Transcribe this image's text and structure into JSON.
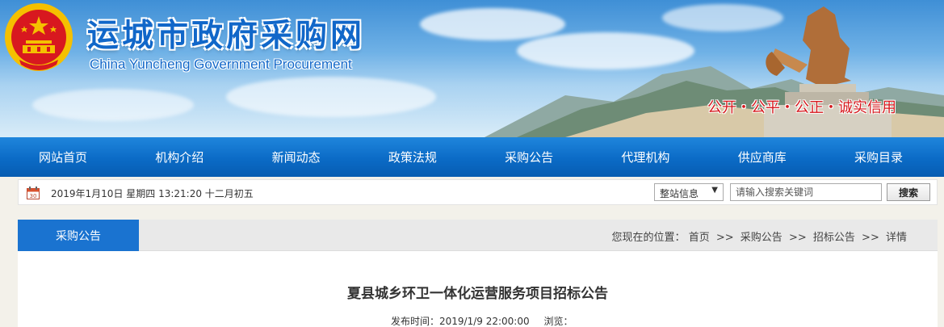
{
  "header": {
    "title": "运城市政府采购网",
    "subtitle": "China Yuncheng Government Procurement",
    "motto": "公开・公平・公正・诚实信用"
  },
  "nav": {
    "items": [
      {
        "label": "网站首页"
      },
      {
        "label": "机构介绍"
      },
      {
        "label": "新闻动态"
      },
      {
        "label": "政策法规"
      },
      {
        "label": "采购公告"
      },
      {
        "label": "代理机构"
      },
      {
        "label": "供应商库"
      },
      {
        "label": "采购目录"
      }
    ]
  },
  "infobar": {
    "calendar_day": "30",
    "datetime": "2019年1月10日 星期四 13:21:20 十二月初五",
    "search_scope": "整站信息",
    "search_placeholder": "请输入搜索关键词",
    "search_button": "搜索"
  },
  "section": {
    "tab_label": "采购公告",
    "breadcrumb_prefix": "您现在的位置：",
    "breadcrumb": [
      "首页",
      "采购公告",
      "招标公告",
      "详情"
    ],
    "separator": ">>"
  },
  "article": {
    "title": "夏县城乡环卫一体化运营服务项目招标公告",
    "publish_label": "发布时间：",
    "publish_time": "2019/1/9 22:00:00",
    "views_label": "浏览："
  },
  "colors": {
    "brand_blue": "#1167c9",
    "nav_blue": "#0b6bc6",
    "tab_blue": "#1a73d0",
    "motto_red": "#d6181d",
    "emblem_red": "#d8181f",
    "emblem_gold": "#f5c000"
  },
  "icons": {
    "emblem": "national-emblem-icon",
    "calendar": "calendar-icon",
    "dropdown": "chevron-down-icon"
  }
}
